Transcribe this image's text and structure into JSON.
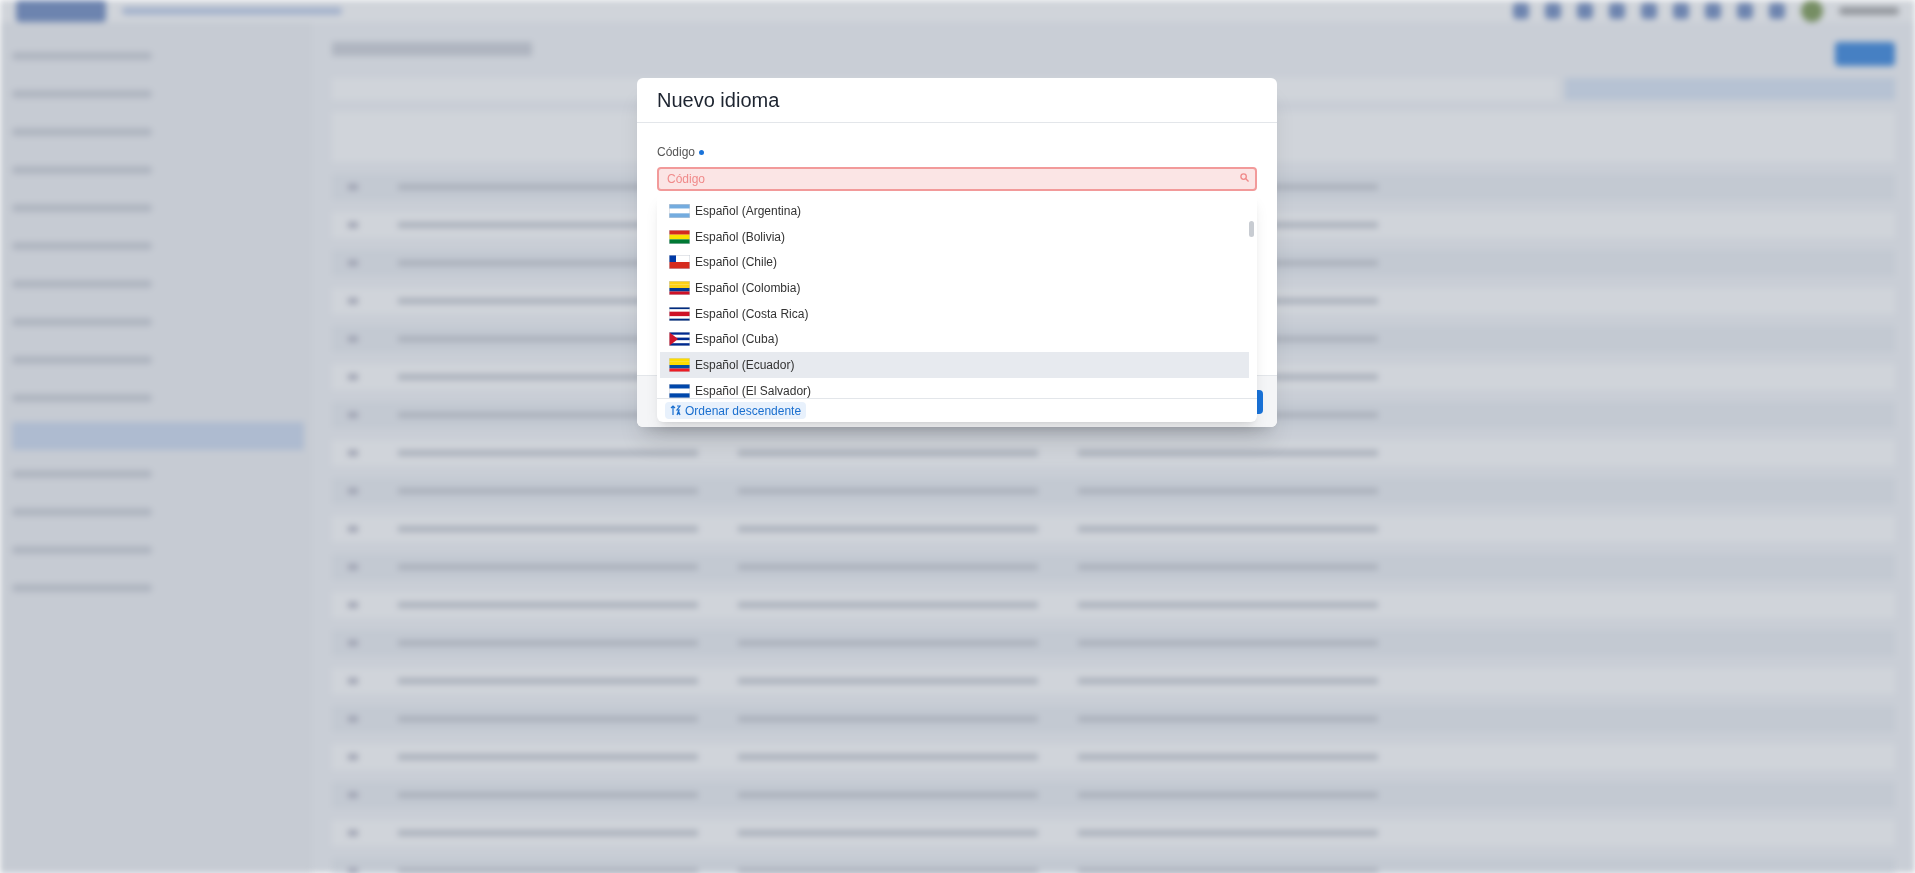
{
  "dialog": {
    "title": "Nuevo idioma",
    "field": {
      "label": "Código",
      "required": true,
      "placeholder": "Código",
      "invalid": true
    },
    "options": [
      {
        "label": "Español (Argentina)",
        "kind": "argentina",
        "selected": false
      },
      {
        "label": "Español (Bolivia)",
        "kind": "bolivia",
        "selected": false
      },
      {
        "label": "Español (Chile)",
        "kind": "chile",
        "selected": false
      },
      {
        "label": "Español (Colombia)",
        "kind": "colombia",
        "selected": false
      },
      {
        "label": "Español (Costa Rica)",
        "kind": "costarica",
        "selected": false
      },
      {
        "label": "Español (Cuba)",
        "kind": "cuba",
        "selected": false
      },
      {
        "label": "Español (Ecuador)",
        "kind": "ecuador",
        "selected": true
      },
      {
        "label": "Español (El Salvador)",
        "kind": "elsalvador",
        "selected": false
      }
    ],
    "sort_button": "Ordenar descendente"
  }
}
